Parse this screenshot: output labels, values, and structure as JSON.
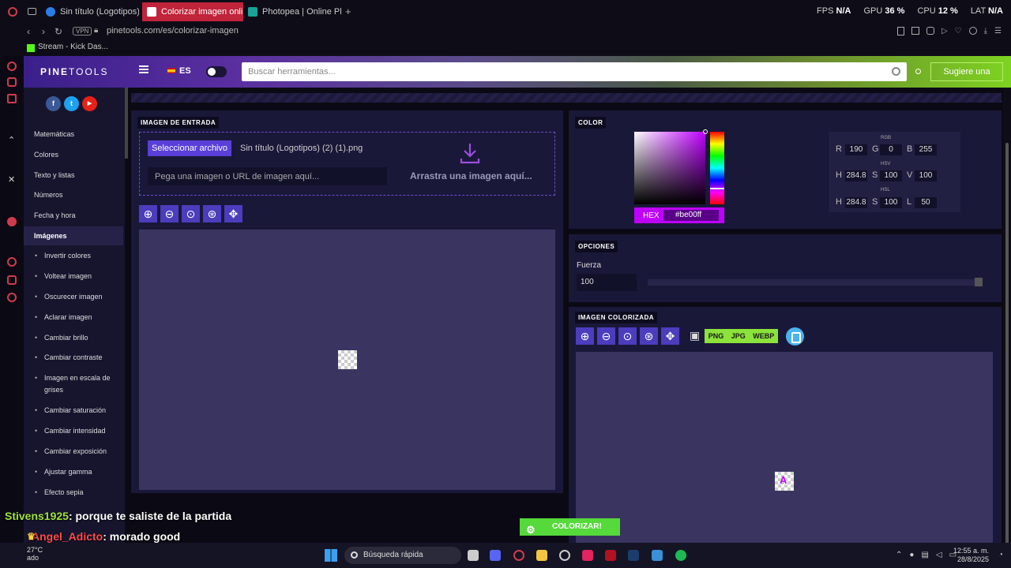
{
  "browser": {
    "tabs": [
      {
        "label": "Sin título (Logotipos) - Lo",
        "color": "#2b7de9"
      },
      {
        "label": "Colorizar imagen online",
        "color": "#ffffff"
      },
      {
        "label": "Photopea | Online Photo E",
        "color": "#18a497"
      }
    ],
    "new_tab": "+",
    "stats": {
      "fps_label": "FPS",
      "fps": "N/A",
      "gpu_label": "GPU",
      "gpu": "36 %",
      "cpu_label": "CPU",
      "cpu": "12 %",
      "lat_label": "LAT",
      "lat": "N/A"
    },
    "vpn": "VPN",
    "url": "pinetools.com/es/colorizar-imagen",
    "bookmark": "Stream - Kick Das..."
  },
  "header": {
    "logo_bold": "PINE",
    "logo_light": "TOOLS",
    "lang": "ES",
    "search_placeholder": "Buscar herramientas...",
    "suggest": "Sugiere una"
  },
  "sidebar": {
    "social": [
      {
        "icon": "facebook-icon",
        "glyph": "f",
        "color": "#3b5998"
      },
      {
        "icon": "twitter-icon",
        "glyph": "t",
        "color": "#1da1f2"
      },
      {
        "icon": "youtube-icon",
        "glyph": "▶",
        "color": "#e62117"
      }
    ],
    "categories": [
      "Matemáticas",
      "Colores",
      "Texto y listas",
      "Números",
      "Fecha y hora"
    ],
    "active": "Imágenes",
    "items": [
      "Invertir colores",
      "Voltear imagen",
      "Oscurecer imagen",
      "Aclarar imagen",
      "Cambiar brillo",
      "Cambiar contraste",
      "Imagen en escala de grises",
      "Cambiar saturación",
      "Cambiar intensidad",
      "Cambiar exposición",
      "Ajustar gamma",
      "Efecto sepia"
    ]
  },
  "input": {
    "title": "IMAGEN DE ENTRADA",
    "select_button": "Seleccionar archivo",
    "filename": "Sin título (Logotipos) (2) (1).png",
    "url_placeholder": "Pega una imagen o URL de imagen aquí...",
    "drop_text": "Arrastra una imagen aquí..."
  },
  "color": {
    "title": "COLOR",
    "hex_label": "HEX",
    "hex": "#be00ff",
    "rgb_label": "RGB",
    "r": "190",
    "g": "0",
    "b": "255",
    "hsv_label": "HSV",
    "hsv_h": "284.8",
    "hsv_s": "100",
    "hsv_v": "100",
    "hsl_label": "HSL",
    "hsl_h": "284.8",
    "hsl_s": "100",
    "hsl_l": "50"
  },
  "options": {
    "title": "OPCIONES",
    "strength_label": "Fuerza",
    "strength": "100"
  },
  "output": {
    "title": "IMAGEN COLORIZADA",
    "formats": [
      "PNG",
      "JPG",
      "WEBP"
    ]
  },
  "colorize_button": "COLORIZAR!",
  "chat": [
    {
      "user": "Stivens1925",
      "msg": ": porque te saliste de la partida"
    },
    {
      "user": "Angel_Adicto",
      "msg": ": morado good"
    }
  ],
  "taskbar": {
    "temp": "27°C",
    "weather": "ado",
    "search": "Búsqueda rápida",
    "time": "12:55 a. m.",
    "date": "28/8/2025"
  }
}
